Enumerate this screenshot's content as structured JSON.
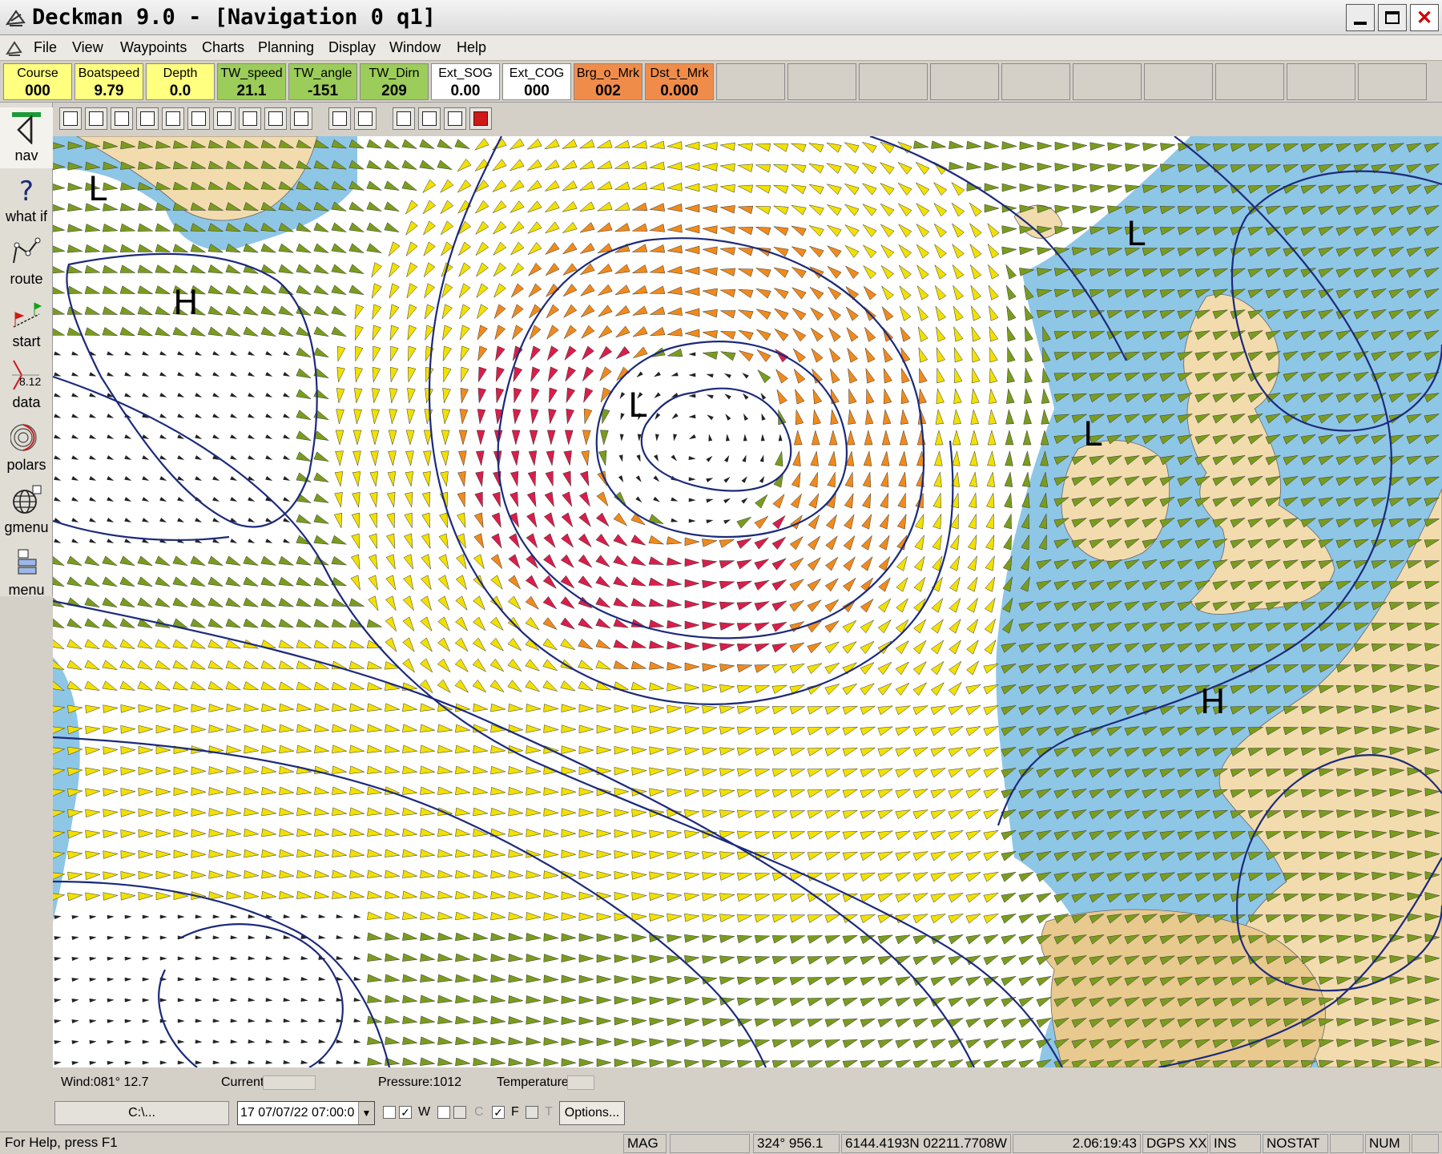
{
  "window": {
    "title": "Deckman 9.0 - [Navigation 0 q1]"
  },
  "menu": {
    "items": [
      "File",
      "View",
      "Waypoints",
      "Charts",
      "Planning",
      "Display",
      "Window",
      "Help"
    ]
  },
  "instruments": [
    {
      "label": "Course",
      "value": "000",
      "color": "#ffff80"
    },
    {
      "label": "Boatspeed",
      "value": "9.79",
      "color": "#ffff80"
    },
    {
      "label": "Depth",
      "value": "0.0",
      "color": "#ffff80"
    },
    {
      "label": "TW_speed",
      "value": "21.1",
      "color": "#9ccc5a"
    },
    {
      "label": "TW_angle",
      "value": "-151",
      "color": "#9ccc5a"
    },
    {
      "label": "TW_Dirn",
      "value": "209",
      "color": "#9ccc5a"
    },
    {
      "label": "Ext_SOG",
      "value": "0.00",
      "color": "#ffffff"
    },
    {
      "label": "Ext_COG",
      "value": "000",
      "color": "#ffffff"
    },
    {
      "label": "Brg_o_Mrk",
      "value": "002",
      "color": "#f08c4a"
    },
    {
      "label": "Dst_t_Mrk",
      "value": "0.000",
      "color": "#f08c4a"
    }
  ],
  "rail": {
    "nav": "nav",
    "whatif": "what if",
    "route": "route",
    "start": "start",
    "data": "data",
    "data_num": "8.12",
    "polars": "polars",
    "gmenu": "gmenu",
    "menu": "menu"
  },
  "map": {
    "sea_color": "#8ec6e6",
    "land_color": "#f2dcae",
    "isobar_color": "#1c2a7a",
    "pressure_labels": [
      {
        "text": "L",
        "kind": "low"
      },
      {
        "text": "H",
        "kind": "high"
      },
      {
        "text": "L",
        "kind": "low"
      },
      {
        "text": "L",
        "kind": "low"
      },
      {
        "text": "L",
        "kind": "low"
      },
      {
        "text": "H",
        "kind": "high"
      }
    ],
    "wind_colors": [
      "#7a9c1e",
      "#f2e000",
      "#f08a1c",
      "#d81e4a"
    ]
  },
  "info": {
    "wind": "Wind:081° 12.7",
    "current": "Current:",
    "pressure": "Pressure:1012",
    "temperature": "Temperature"
  },
  "controls": {
    "path": "C:\\...",
    "time": "17 07/07/22 07:00:0",
    "checks": [
      {
        "label": "W",
        "checked": true
      },
      {
        "label": "C",
        "checked": false
      },
      {
        "label": "F",
        "checked": true
      },
      {
        "label": "T",
        "checked": false
      }
    ],
    "options_label": "Options..."
  },
  "status": {
    "help": "For Help, press F1",
    "mag": "MAG",
    "bearing": "324° 956.1",
    "position": "6144.4193N 02211.7708W",
    "time": "2.06:19:43",
    "gps": "DGPS XX",
    "ins": "INS",
    "nostat": "NOSTAT",
    "num": "NUM"
  }
}
